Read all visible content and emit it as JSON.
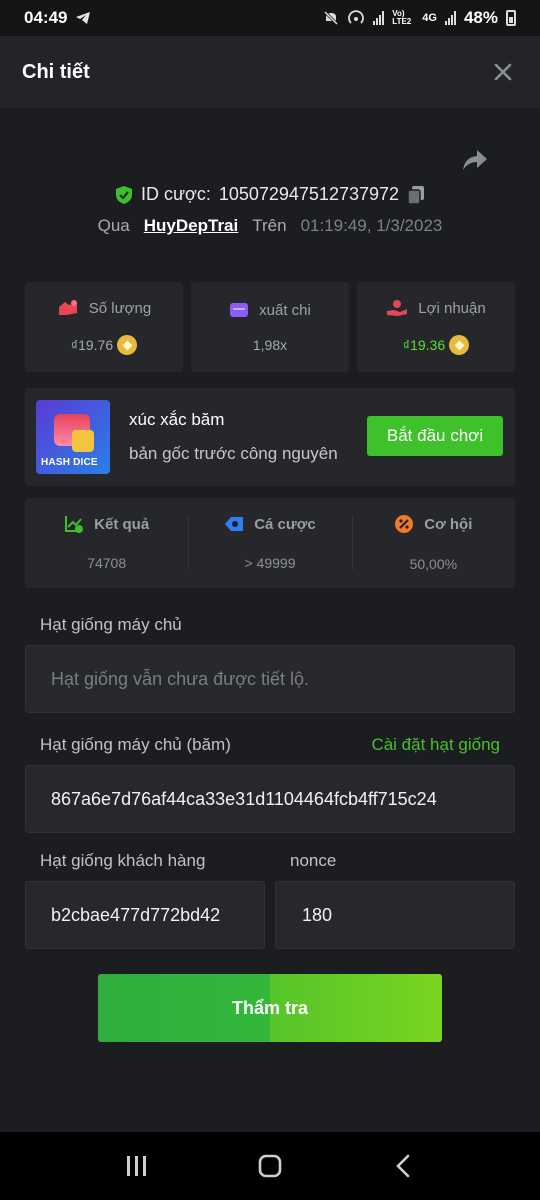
{
  "status_bar": {
    "time": "04:49",
    "network_label": "Vo) LTE2",
    "network_type": "4G",
    "battery": "48%"
  },
  "header": {
    "title": "Chi tiết",
    "close_icon": "close-icon"
  },
  "bet": {
    "id_label": "ID cược:",
    "id_value": "105072947512737972",
    "by_label": "Qua",
    "username": "HuyDepTrai",
    "on_label": "Trên",
    "timestamp": "01:19:49, 1/3/2023"
  },
  "stats": [
    {
      "label": "Số lượng",
      "value": "₫19.76",
      "icon": "amount-icon",
      "color": "#e8445a"
    },
    {
      "label": "xuất chi",
      "value": "1,98x",
      "icon": "wallet-icon",
      "color": "#8b5cf6"
    },
    {
      "label": "Lợi nhuận",
      "value": "₫19.36",
      "icon": "profit-icon",
      "color": "#e8445a"
    }
  ],
  "game": {
    "thumb_label": "HASH DICE",
    "name": "xúc xắc băm",
    "subtitle": "bản gốc trước công nguyên",
    "play_label": "Bắt đầu chơi"
  },
  "result": [
    {
      "label": "Kết quả",
      "value": "74708",
      "icon": "result-icon",
      "color": "#3fbf2a"
    },
    {
      "label": "Cá cược",
      "value": "> 49999",
      "icon": "bet-icon",
      "color": "#2f7df0"
    },
    {
      "label": "Cơ hội",
      "value": "50,00%",
      "icon": "chance-icon",
      "color": "#f07a2a"
    }
  ],
  "seeds": {
    "server_seed_label": "Hạt giống máy chủ",
    "server_seed_placeholder": "Hạt giống vẫn chưa được tiết lộ.",
    "server_hash_label": "Hạt giống máy chủ (băm)",
    "set_seed_link": "Cài đặt hạt giống",
    "server_hash_value": "867a6e7d76af44ca33e31d1104464fcb4ff715c24",
    "client_seed_label": "Hạt giống khách hàng",
    "client_seed_value": "b2cbae477d772bd42",
    "nonce_label": "nonce",
    "nonce_value": "180"
  },
  "verify_label": "Thẩm tra",
  "colors": {
    "accent_green": "#43c22a",
    "background": "#1c1d20",
    "card": "#26272b"
  }
}
